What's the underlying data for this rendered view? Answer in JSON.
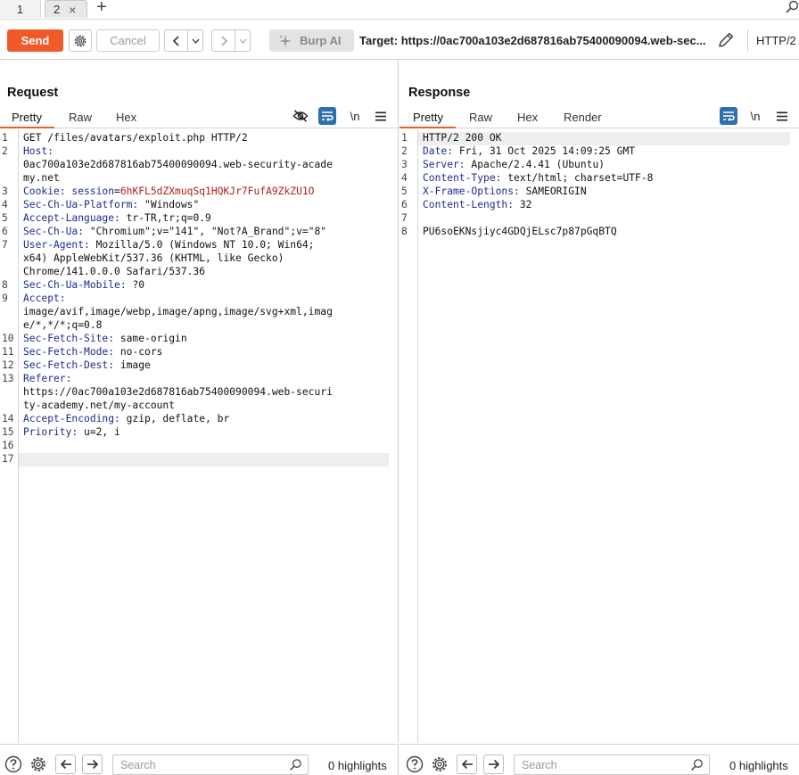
{
  "tabs": [
    {
      "label": "1"
    },
    {
      "label": "2",
      "close": "×"
    }
  ],
  "tab_add": "+",
  "toolbar": {
    "send_label": "Send",
    "cancel_label": "Cancel",
    "burp_ai_label": "Burp AI",
    "target_label": "Target: https://0ac700a103e2d687816ab75400090094.web-sec...",
    "protocol_label": "HTTP/2",
    "back_icon": "‹",
    "fwd_icon": "›"
  },
  "request": {
    "title": "Request",
    "tabs": [
      "Pretty",
      "Raw",
      "Hex"
    ],
    "newline_label": "\\n",
    "lines": [
      {
        "n": "1",
        "parts": [
          {
            "t": "GET /files/avatars/exploit.php HTTP/2",
            "c": ""
          }
        ]
      },
      {
        "n": "2",
        "parts": [
          {
            "t": "Host:",
            "c": "hk"
          }
        ]
      },
      {
        "n": "",
        "parts": [
          {
            "t": "0ac700a103e2d687816ab75400090094.web-security-acade",
            "c": ""
          }
        ]
      },
      {
        "n": "",
        "parts": [
          {
            "t": "my.net",
            "c": ""
          }
        ]
      },
      {
        "n": "3",
        "parts": [
          {
            "t": "Cookie: ",
            "c": "hk"
          },
          {
            "t": "session",
            "c": "ck"
          },
          {
            "t": "=",
            "c": ""
          },
          {
            "t": "6hKFL5dZXmuqSq1HQKJr7FufA9ZkZU1O",
            "c": "cv"
          }
        ]
      },
      {
        "n": "4",
        "parts": [
          {
            "t": "Sec-Ch-Ua-Platform: ",
            "c": "hk"
          },
          {
            "t": "\"Windows\"",
            "c": ""
          }
        ]
      },
      {
        "n": "5",
        "parts": [
          {
            "t": "Accept-Language: ",
            "c": "hk"
          },
          {
            "t": "tr-TR,tr;q=0.9",
            "c": ""
          }
        ]
      },
      {
        "n": "6",
        "parts": [
          {
            "t": "Sec-Ch-Ua: ",
            "c": "hk"
          },
          {
            "t": "\"Chromium\";v=\"141\", \"Not?A_Brand\";v=\"8\"",
            "c": ""
          }
        ]
      },
      {
        "n": "7",
        "parts": [
          {
            "t": "User-Agent: ",
            "c": "hk"
          },
          {
            "t": "Mozilla/5.0 (Windows NT 10.0; Win64;",
            "c": ""
          }
        ]
      },
      {
        "n": "",
        "parts": [
          {
            "t": "x64) AppleWebKit/537.36 (KHTML, like Gecko)",
            "c": ""
          }
        ]
      },
      {
        "n": "",
        "parts": [
          {
            "t": "Chrome/141.0.0.0 Safari/537.36",
            "c": ""
          }
        ]
      },
      {
        "n": "8",
        "parts": [
          {
            "t": "Sec-Ch-Ua-Mobile: ",
            "c": "hk"
          },
          {
            "t": "?0",
            "c": ""
          }
        ]
      },
      {
        "n": "9",
        "parts": [
          {
            "t": "Accept:",
            "c": "hk"
          }
        ]
      },
      {
        "n": "",
        "parts": [
          {
            "t": "image/avif,image/webp,image/apng,image/svg+xml,imag",
            "c": ""
          }
        ]
      },
      {
        "n": "",
        "parts": [
          {
            "t": "e/*,*/*;q=0.8",
            "c": ""
          }
        ]
      },
      {
        "n": "10",
        "parts": [
          {
            "t": "Sec-Fetch-Site: ",
            "c": "hk"
          },
          {
            "t": "same-origin",
            "c": ""
          }
        ]
      },
      {
        "n": "11",
        "parts": [
          {
            "t": "Sec-Fetch-Mode: ",
            "c": "hk"
          },
          {
            "t": "no-cors",
            "c": ""
          }
        ]
      },
      {
        "n": "12",
        "parts": [
          {
            "t": "Sec-Fetch-Dest: ",
            "c": "hk"
          },
          {
            "t": "image",
            "c": ""
          }
        ]
      },
      {
        "n": "13",
        "parts": [
          {
            "t": "Referer:",
            "c": "hk"
          }
        ]
      },
      {
        "n": "",
        "parts": [
          {
            "t": "https://0ac700a103e2d687816ab75400090094.web-securi",
            "c": ""
          }
        ]
      },
      {
        "n": "",
        "parts": [
          {
            "t": "ty-academy.net/my-account",
            "c": ""
          }
        ]
      },
      {
        "n": "14",
        "parts": [
          {
            "t": "Accept-Encoding: ",
            "c": "hk"
          },
          {
            "t": "gzip, deflate, br",
            "c": ""
          }
        ]
      },
      {
        "n": "15",
        "parts": [
          {
            "t": "Priority: ",
            "c": "hk"
          },
          {
            "t": "u=2, i",
            "c": ""
          }
        ]
      },
      {
        "n": "16",
        "parts": []
      },
      {
        "n": "17",
        "parts": []
      }
    ],
    "search_placeholder": "Search",
    "highlights": "0 highlights"
  },
  "response": {
    "title": "Response",
    "tabs": [
      "Pretty",
      "Raw",
      "Hex",
      "Render"
    ],
    "newline_label": "\\n",
    "lines": [
      {
        "n": "1",
        "parts": [
          {
            "t": "HTTP/2 200 OK",
            "c": ""
          }
        ]
      },
      {
        "n": "2",
        "parts": [
          {
            "t": "Date: ",
            "c": "hk"
          },
          {
            "t": "Fri, 31 Oct 2025 14:09:25 GMT",
            "c": ""
          }
        ]
      },
      {
        "n": "3",
        "parts": [
          {
            "t": "Server: ",
            "c": "hk"
          },
          {
            "t": "Apache/2.4.41 (Ubuntu)",
            "c": ""
          }
        ]
      },
      {
        "n": "4",
        "parts": [
          {
            "t": "Content-Type: ",
            "c": "hk"
          },
          {
            "t": "text/html; charset=UTF-8",
            "c": ""
          }
        ]
      },
      {
        "n": "5",
        "parts": [
          {
            "t": "X-Frame-Options: ",
            "c": "hk"
          },
          {
            "t": "SAMEORIGIN",
            "c": ""
          }
        ]
      },
      {
        "n": "6",
        "parts": [
          {
            "t": "Content-Length: ",
            "c": "hk"
          },
          {
            "t": "32",
            "c": ""
          }
        ]
      },
      {
        "n": "7",
        "parts": []
      },
      {
        "n": "8",
        "parts": [
          {
            "t": "PU6soEKNsjiyc4GDQjELsc7p87pGqBTQ",
            "c": ""
          }
        ]
      }
    ],
    "search_placeholder": "Search",
    "highlights": "0 highlights"
  }
}
